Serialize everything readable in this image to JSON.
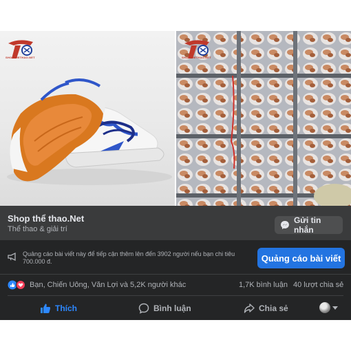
{
  "post": {
    "page_name": "Shop thể thao.Net",
    "page_category": "Thể thao & giải trí",
    "message_button": "Gửi tin nhắn",
    "logo_text": "SHOPTHETHAO.NET"
  },
  "boost": {
    "text": "Quảng cáo bài viết này để tiếp cận thêm lên đến 3902 người nếu bạn chi tiêu 700.000 đ.",
    "button": "Quảng cáo bài viết"
  },
  "reactions": {
    "names": "Bạn, Chiến Uông, Văn Lợi và 5,2K người khác",
    "comments": "1,7K bình luận",
    "shares": "40 lượt chia sẻ"
  },
  "actions": {
    "like": "Thích",
    "comment": "Bình luận",
    "share": "Chia sẻ"
  },
  "colors": {
    "accent": "#2374e1",
    "like_active": "#2d88ff",
    "card_bg": "#242526",
    "info_bg": "#3a3b3c",
    "logo_red": "#c0392b"
  }
}
